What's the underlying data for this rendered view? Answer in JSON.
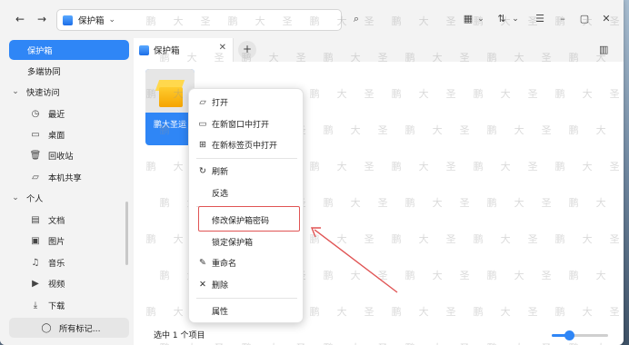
{
  "colors": {
    "accent": "#2f86f6",
    "annotation": "#e05454"
  },
  "address_bar": {
    "path": "保护箱",
    "icon": "safe-icon"
  },
  "toolbar": {
    "search_icon": "⌕",
    "grid_icon": "▦",
    "sort_icon": "⇅",
    "list_icon": "☰",
    "minimize": "–",
    "maximize": "▢",
    "close": "✕",
    "back": "←",
    "forward": "→",
    "chevron": "⌄"
  },
  "sidebar": {
    "top_items": [
      {
        "label": "保护箱",
        "active": true
      },
      {
        "label": "多端协同",
        "active": false
      }
    ],
    "quick_access": {
      "title": "快速访问",
      "items": [
        {
          "label": "最近",
          "icon": "clock-icon",
          "glyph": "◷"
        },
        {
          "label": "桌面",
          "icon": "desktop-icon",
          "glyph": "▭"
        },
        {
          "label": "回收站",
          "icon": "trash-icon",
          "glyph": "🗑"
        },
        {
          "label": "本机共享",
          "icon": "folder-icon",
          "glyph": "▱"
        }
      ]
    },
    "personal": {
      "title": "个人",
      "items": [
        {
          "label": "文档",
          "icon": "document-icon",
          "glyph": "▤"
        },
        {
          "label": "图片",
          "icon": "image-icon",
          "glyph": "▣"
        },
        {
          "label": "音乐",
          "icon": "music-icon",
          "glyph": "♫"
        },
        {
          "label": "视频",
          "icon": "video-icon",
          "glyph": "▶"
        },
        {
          "label": "下载",
          "icon": "download-icon",
          "glyph": "⤓"
        }
      ]
    },
    "tags": {
      "label": "所有标记...",
      "glyph": "◯"
    }
  },
  "tabs": [
    {
      "label": "保护箱",
      "close": "✕"
    }
  ],
  "tab_add": "+",
  "files": [
    {
      "name": "鹏大圣运"
    }
  ],
  "status": {
    "text": "选中 1 个项目",
    "zoom_level": 0.3
  },
  "context_menu": {
    "items": [
      {
        "label": "打开",
        "glyph": "▱",
        "icon": "open-folder-icon"
      },
      {
        "label": "在新窗口中打开",
        "glyph": "▭",
        "icon": "new-window-icon"
      },
      {
        "label": "在新标签页中打开",
        "glyph": "⊞",
        "icon": "new-tab-icon"
      },
      {
        "label": "刷新",
        "glyph": "↻",
        "icon": "refresh-icon"
      },
      {
        "label": "反选",
        "glyph": "",
        "icon": ""
      },
      {
        "label": "修改保护箱密码",
        "glyph": "",
        "icon": ""
      },
      {
        "label": "锁定保护箱",
        "glyph": "",
        "icon": ""
      },
      {
        "label": "重命名",
        "glyph": "✎",
        "icon": "rename-icon"
      },
      {
        "label": "删除",
        "glyph": "✕",
        "icon": "delete-icon"
      },
      {
        "label": "属性",
        "glyph": "",
        "icon": ""
      }
    ]
  },
  "watermark_text": [
    "鹏",
    "大",
    "圣"
  ]
}
